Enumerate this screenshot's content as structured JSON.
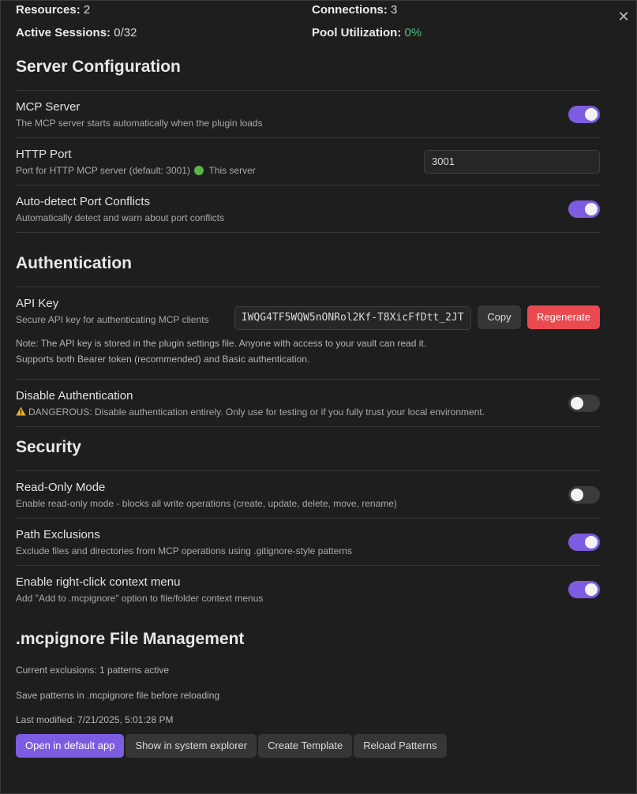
{
  "stats": {
    "resources_label": "Resources:",
    "resources_value": "2",
    "connections_label": "Connections:",
    "connections_value": "3",
    "sessions_label": "Active Sessions:",
    "sessions_value": "0/32",
    "pool_label": "Pool Utilization:",
    "pool_value": "0%"
  },
  "server": {
    "heading": "Server Configuration",
    "mcp": {
      "title": "MCP Server",
      "desc": "The MCP server starts automatically when the plugin loads",
      "enabled": true
    },
    "port": {
      "title": "HTTP Port",
      "desc": "Port for HTTP MCP server (default: 3001)",
      "status": "This server",
      "value": "3001"
    },
    "autodetect": {
      "title": "Auto-detect Port Conflicts",
      "desc": "Automatically detect and warn about port conflicts",
      "enabled": true
    }
  },
  "auth": {
    "heading": "Authentication",
    "apikey": {
      "title": "API Key",
      "desc": "Secure API key for authenticating MCP clients",
      "value": "IWQG4TF5WQW5nONRol2Kf-T8XicFfDtt_2JT",
      "copy_label": "Copy",
      "regenerate_label": "Regenerate",
      "note1": "Note: The API key is stored in the plugin settings file. Anyone with access to your vault can read it.",
      "note2": "Supports both Bearer token (recommended) and Basic authentication."
    },
    "disable": {
      "title": "Disable Authentication",
      "desc": "DANGEROUS: Disable authentication entirely. Only use for testing or if you fully trust your local environment.",
      "enabled": false
    }
  },
  "security": {
    "heading": "Security",
    "readonly": {
      "title": "Read-Only Mode",
      "desc": "Enable read-only mode - blocks all write operations (create, update, delete, move, rename)",
      "enabled": false
    },
    "exclusions": {
      "title": "Path Exclusions",
      "desc": "Exclude files and directories from MCP operations using .gitignore-style patterns",
      "enabled": true
    },
    "context": {
      "title": "Enable right-click context menu",
      "desc": "Add \"Add to .mcpignore\" option to file/folder context menus",
      "enabled": true
    }
  },
  "ignore": {
    "heading": ".mcpignore File Management",
    "current": "Current exclusions: 1 patterns active",
    "save_hint": "Save patterns in .mcpignore file before reloading",
    "modified": "Last modified: 7/21/2025, 5:01:28 PM",
    "open_label": "Open in default app",
    "explorer_label": "Show in system explorer",
    "template_label": "Create Template",
    "reload_label": "Reload Patterns"
  },
  "colors": {
    "accent": "#7c5ce0",
    "danger": "#e84a4f",
    "success": "#4fc27a"
  }
}
